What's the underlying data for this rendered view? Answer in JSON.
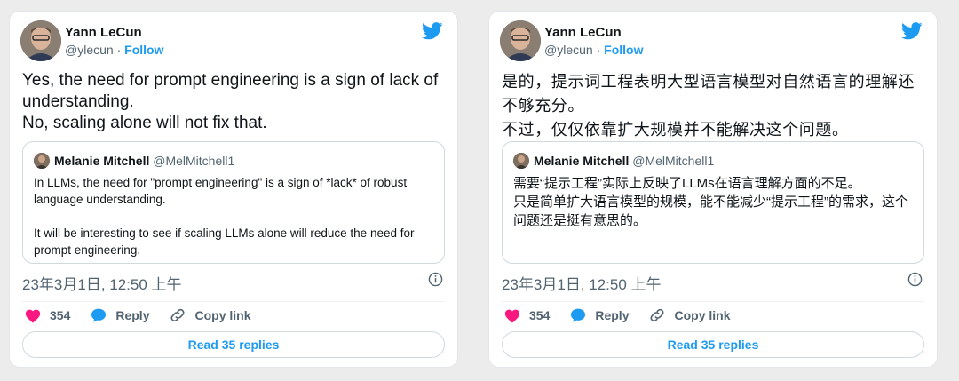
{
  "colors": {
    "accent": "#1d9bf0",
    "like": "#f91880",
    "muted": "#536471"
  },
  "tweets": [
    {
      "author": {
        "name": "Yann LeCun",
        "handle": "@ylecun",
        "separator": " · ",
        "follow": "Follow"
      },
      "text": "Yes, the need for prompt engineering is a sign of lack of understanding.\nNo, scaling alone will not fix that.",
      "quote": {
        "name": "Melanie Mitchell",
        "handle": "@MelMitchell1",
        "text": "In LLMs, the need for \"prompt engineering\" is a sign of *lack* of robust language understanding.\n\nIt will be interesting to see if scaling LLMs alone will reduce the need for prompt engineering."
      },
      "timestamp": "23年3月1日, 12:50 上午",
      "actions": {
        "likes": "354",
        "reply": "Reply",
        "copy_link": "Copy link"
      },
      "read_replies": "Read 35 replies"
    },
    {
      "author": {
        "name": "Yann LeCun",
        "handle": "@ylecun",
        "separator": " · ",
        "follow": "Follow"
      },
      "text": "是的，提示词工程表明大型语言模型对自然语言的理解还不够充分。\n不过，仅仅依靠扩大规模并不能解决这个问题。",
      "quote": {
        "name": "Melanie Mitchell",
        "handle": "@MelMitchell1",
        "text": "需要“提示工程”实际上反映了LLMs在语言理解方面的不足。\n只是简单扩大语言模型的规模，能不能减少“提示工程”的需求，这个问题还是挺有意思的。"
      },
      "timestamp": "23年3月1日, 12:50 上午",
      "actions": {
        "likes": "354",
        "reply": "Reply",
        "copy_link": "Copy link"
      },
      "read_replies": "Read 35 replies"
    }
  ]
}
